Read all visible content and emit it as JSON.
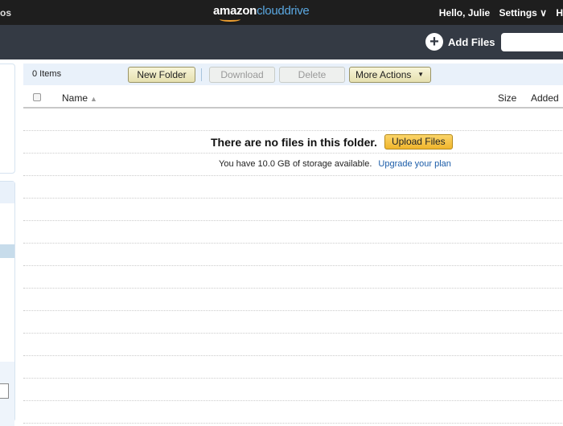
{
  "topbar": {
    "nav_left": "os",
    "logo_amazon": "amazon",
    "logo_cloud": "cloud",
    "logo_drive": "drive",
    "greeting": "Hello, Julie",
    "settings": "Settings",
    "settings_chevron": "chevron-down-icon",
    "help_partial": "H"
  },
  "subbar": {
    "add_files": "Add Files",
    "add_icon": "plus-circle-icon",
    "search_placeholder": ""
  },
  "toolbar": {
    "count": "0 Items",
    "new_folder": "New Folder",
    "download": "Download",
    "delete": "Delete",
    "more_actions": "More Actions",
    "more_arrow": "▼"
  },
  "table": {
    "columns": {
      "name": "Name",
      "sort": "▲",
      "size": "Size",
      "added": "Added"
    }
  },
  "empty": {
    "message": "There are no files in this folder.",
    "upload": "Upload Files",
    "storage": "You have 10.0 GB of storage available.",
    "upgrade": "Upgrade your plan"
  },
  "colors": {
    "topbar": "#1e1e1e",
    "subbar": "#343a44",
    "toolbar": "#e9f1fa",
    "upload": "#f0b52c",
    "link": "#1b5ca8"
  }
}
